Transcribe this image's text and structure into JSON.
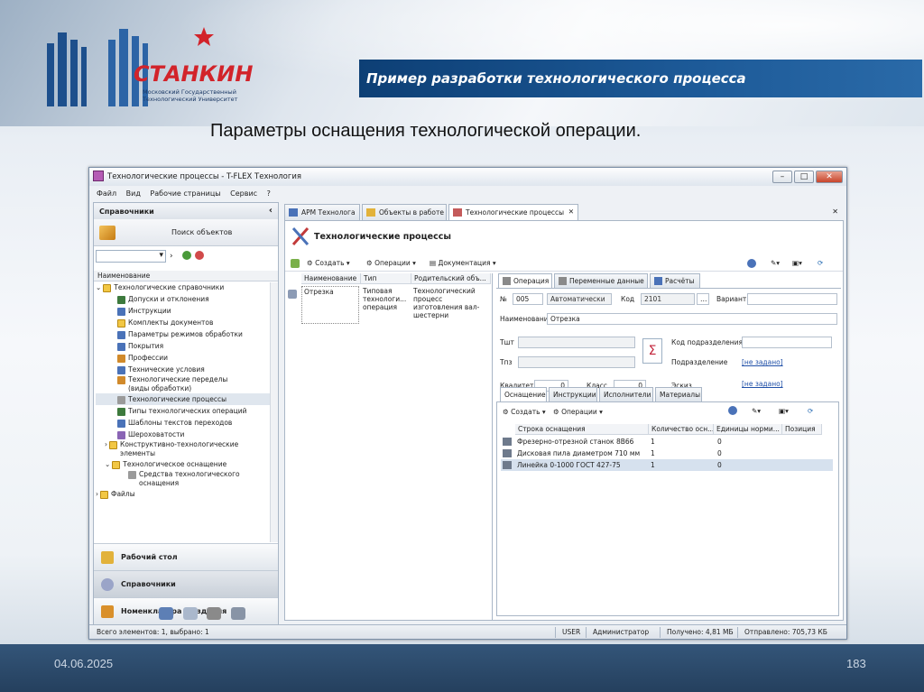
{
  "slide": {
    "header_title": "Пример разработки технологического процесса",
    "subtitle": "Параметры оснащения технологической операции.",
    "logo_text": "СТАНКИН",
    "logo_sub1": "Московский Государственный",
    "logo_sub2": "Технологический Университет",
    "date": "04.06.2025",
    "page_number": "183"
  },
  "window": {
    "title": "Технологические процессы - T-FLEX Технология",
    "menu": [
      "Файл",
      "Вид",
      "Рабочие страницы",
      "Сервис",
      "?"
    ]
  },
  "left_panel": {
    "header": "Справочники",
    "search_label": "Поиск объектов",
    "tree_header": "Наименование",
    "tree": [
      {
        "label": "Технологические справочники",
        "icon": "folder-icon",
        "expanded": true
      },
      {
        "label": "Допуски и отклонения",
        "icon": "table-icon"
      },
      {
        "label": "Инструкции",
        "icon": "doc-icon"
      },
      {
        "label": "Комплекты документов",
        "icon": "folder-icon"
      },
      {
        "label": "Параметры режимов обработки",
        "icon": "params-icon"
      },
      {
        "label": "Покрытия",
        "icon": "coating-icon"
      },
      {
        "label": "Профессии",
        "icon": "people-icon"
      },
      {
        "label": "Технические условия",
        "icon": "doc-icon"
      },
      {
        "label": "Технологические переделы (виды обработки)",
        "icon": "process-icon"
      },
      {
        "label": "Технологические процессы",
        "icon": "tools-icon",
        "selected": true
      },
      {
        "label": "Типы технологических операций",
        "icon": "optype-icon"
      },
      {
        "label": "Шаблоны текстов переходов",
        "icon": "template-icon"
      },
      {
        "label": "Шероховатости",
        "icon": "roughness-icon"
      },
      {
        "label": "Конструктивно-технологические элементы",
        "icon": "folder-icon"
      },
      {
        "label": "Технологическое оснащение",
        "icon": "folder-icon",
        "expanded": true
      },
      {
        "label": "Средства технологического оснащения",
        "icon": "equipment-icon"
      },
      {
        "label": "Файлы",
        "icon": "folder-icon"
      }
    ],
    "nav_buttons": [
      "Рабочий стол",
      "Справочники",
      "Номенклатура и изделия"
    ]
  },
  "tabs": [
    "АРМ Технолога",
    "Объекты в работе",
    "Технологические процессы"
  ],
  "document": {
    "title": "Технологические процессы",
    "toolbar": {
      "create": "Создать",
      "operations": "Операции",
      "documentation": "Документация"
    },
    "grid": {
      "columns": [
        "Наименование",
        "Тип",
        "Родительский объ..."
      ],
      "row": {
        "name": "Отрезка",
        "type": "Типовая технологи... операция",
        "parent": "Технологический процесс изготовления вал-шестерни"
      }
    }
  },
  "operation": {
    "tabs": [
      "Операция",
      "Переменные данные",
      "Расчёты"
    ],
    "num_label": "№",
    "num_value": "005",
    "mode_value": "Автоматически",
    "code_label": "Код",
    "code_value": "2101",
    "variant_label": "Вариант",
    "name_label": "Наименование",
    "name_value": "Отрезка",
    "tsht_label": "Тшт",
    "tpz_label": "Тпз",
    "dept_code_label": "Код подразделения",
    "dept_label": "Подразделение",
    "dept_value": "[не задано]",
    "qualitet_label": "Квалитет",
    "qualitet_value": "0",
    "class_label": "Класс",
    "class_value": "0",
    "sketch_label": "Эскиз",
    "sketch_value": "[не задано]",
    "sigma": "Σ",
    "subtabs": [
      "Оснащение",
      "Инструкции",
      "Исполнители",
      "Материалы"
    ],
    "sub_toolbar": {
      "create": "Создать",
      "operations": "Операции"
    },
    "equip_columns": [
      "Строка оснащения",
      "Количество осн...",
      "Единицы норми...",
      "Позиция"
    ],
    "equip_rows": [
      {
        "name": "Фрезерно-отрезной станок 8В66",
        "qty": "1",
        "unit": "0"
      },
      {
        "name": "Дисковая пила диаметром 710 мм",
        "qty": "1",
        "unit": "0"
      },
      {
        "name": "Линейка 0-1000 ГОСТ 427-75",
        "qty": "1",
        "unit": "0",
        "selected": true
      }
    ]
  },
  "statusbar": {
    "total": "Всего элементов: 1, выбрано: 1",
    "user": "USER",
    "role": "Администратор",
    "received": "Получено: 4,81 МБ",
    "sent": "Отправлено: 705,73 КБ"
  }
}
